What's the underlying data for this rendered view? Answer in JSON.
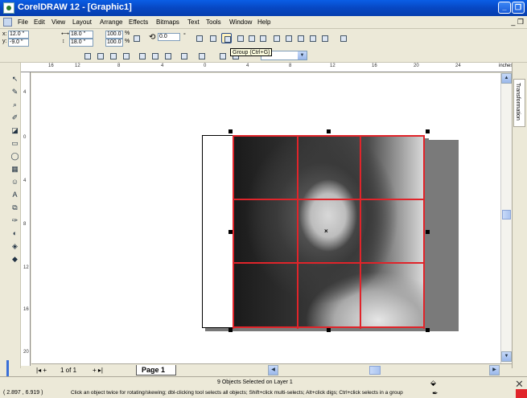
{
  "window": {
    "title": "CorelDRAW 12 - [Graphic1]"
  },
  "menu": {
    "items": [
      "File",
      "Edit",
      "View",
      "Layout",
      "Arrange",
      "Effects",
      "Bitmaps",
      "Text",
      "Tools",
      "Window",
      "Help"
    ]
  },
  "propbar": {
    "x_label": "x:",
    "x_value": "12.0 \"",
    "y_label": "y:",
    "y_value": "-9.0 \"",
    "width_value": "18.0 \"",
    "height_value": "18.0 \"",
    "scale_w": "100.0",
    "scale_h": "100.0",
    "pct": "%",
    "rotation": "0.0",
    "degree": "°",
    "tooltip": "Group (Ctrl+G)"
  },
  "stdbar": {
    "zoom": "%"
  },
  "rulers": {
    "unit": "inches",
    "top_ticks": [
      "16",
      "12",
      "8",
      "4",
      "0",
      "4",
      "8",
      "12",
      "16",
      "20",
      "24"
    ],
    "left_ticks": [
      "4",
      "0",
      "4",
      "8",
      "12",
      "16",
      "20"
    ]
  },
  "docker": {
    "label": "Transformation"
  },
  "navigator": {
    "page_count": "1 of 1",
    "page_tab": "Page 1"
  },
  "status": {
    "selection": "9 Objects Selected on Layer 1",
    "coords": "( 2.897 , 6.919 )",
    "hint": "Click an object twice for rotating/skewing; dbl-clicking tool selects all objects; Shift+click multi-selects; Alt+click digs; Ctrl+click selects in a group"
  },
  "colors": {
    "grid": "#e0242a",
    "title_bar": "#0a5ee6"
  }
}
